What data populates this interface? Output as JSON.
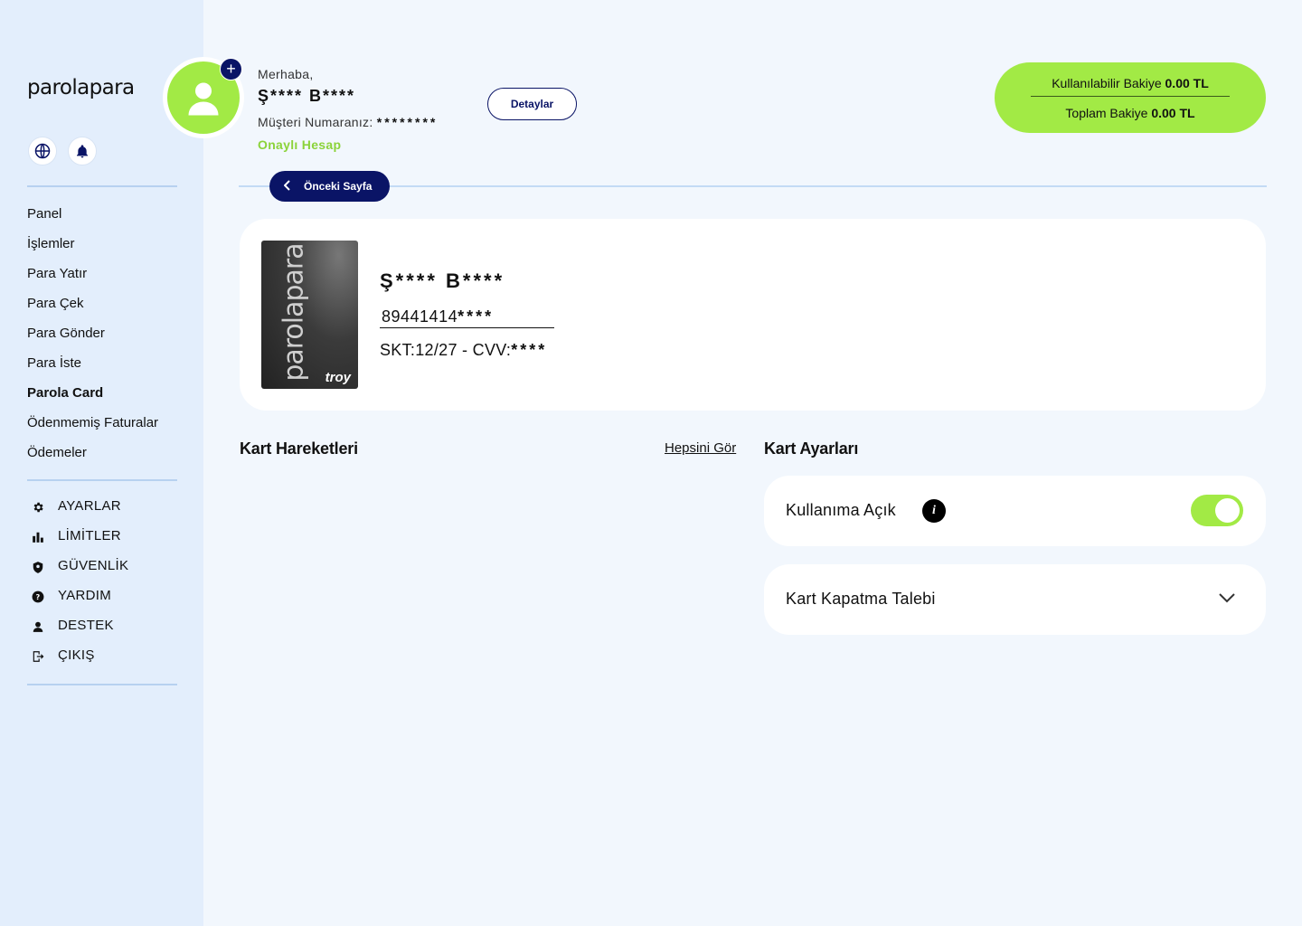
{
  "sidebar": {
    "logo": "parolapara",
    "nav": [
      "Panel",
      "İşlemler",
      "Para Yatır",
      "Para Çek",
      "Para Gönder",
      "Para İste",
      "Parola Card",
      "Ödenmemiş Faturalar",
      "Ödemeler"
    ],
    "active_nav": "Parola Card",
    "settings": [
      {
        "label": "AYARLAR",
        "icon": "gear-icon"
      },
      {
        "label": "LİMİTLER",
        "icon": "bar-chart-icon"
      },
      {
        "label": "GÜVENLİK",
        "icon": "shield-icon"
      },
      {
        "label": "YARDIM",
        "icon": "help-icon"
      },
      {
        "label": "DESTEK",
        "icon": "support-icon"
      },
      {
        "label": "ÇIKIŞ",
        "icon": "logout-icon"
      }
    ]
  },
  "header": {
    "greeting": "Merhaba,",
    "user_name": "Ş**** B****",
    "customer_number_label": "Müşteri Numaranız:",
    "customer_number": "********",
    "status": "Onaylı Hesap",
    "details_button": "Detaylar",
    "available_balance_label": "Kullanılabilir Bakiye",
    "available_balance": "0.00 TL",
    "total_balance_label": "Toplam Bakiye",
    "total_balance": "0.00 TL"
  },
  "back_button": "Önceki Sayfa",
  "card": {
    "holder": "Ş**** B****",
    "number_prefix": "89441414",
    "number_masked": "****",
    "expiry_label": "SKT:12/27 - CVV:",
    "cvv_masked": "****",
    "brand": "parolapara",
    "network": "troy"
  },
  "transactions": {
    "title": "Kart Hareketleri",
    "see_all": "Hepsini Gör"
  },
  "card_settings": {
    "title": "Kart Ayarları",
    "usage_label": "Kullanıma Açık",
    "usage_enabled": true,
    "close_request_label": "Kart Kapatma Talebi"
  },
  "colors": {
    "accent_green": "#a2ea45",
    "navy": "#0a1466",
    "sidebar_bg": "#e3eefc",
    "page_bg": "#f2f7fd"
  }
}
